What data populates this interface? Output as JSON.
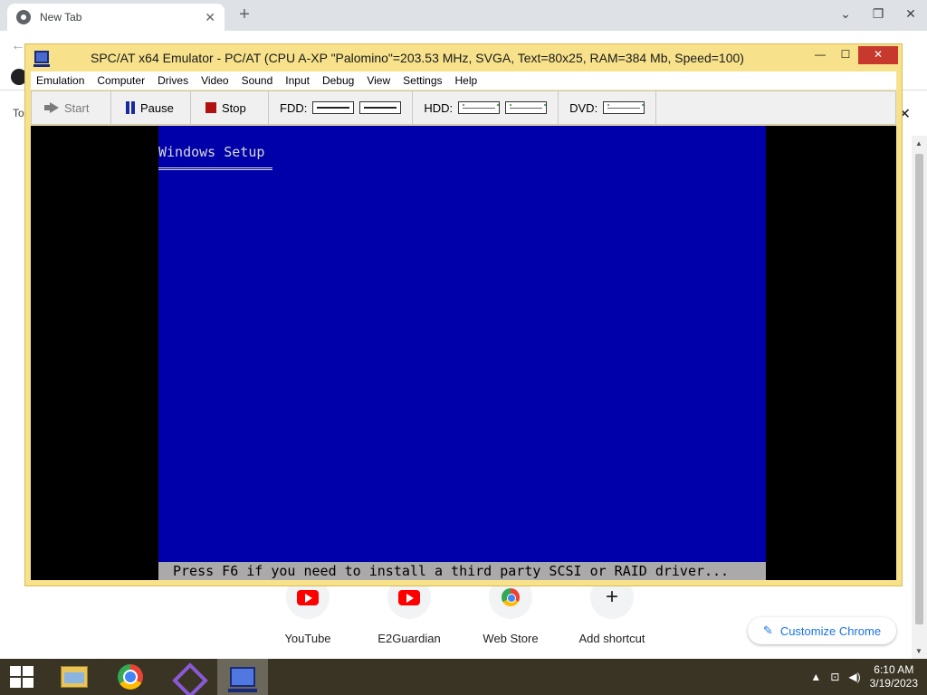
{
  "browser": {
    "tab_title": "New Tab",
    "tab_close": "✕",
    "new_tab": "+",
    "side_label": "To",
    "side_close": "✕",
    "window_controls": [
      "⌄",
      "❐",
      "✕"
    ]
  },
  "shortcuts": [
    {
      "label": "YouTube",
      "icon": "youtube-icon"
    },
    {
      "label": "E2Guardian",
      "icon": "youtube-icon"
    },
    {
      "label": "Web Store",
      "icon": "webstore-icon"
    },
    {
      "label": "Add shortcut",
      "icon": "plus-icon"
    }
  ],
  "customize": {
    "label": "Customize Chrome",
    "icon": "✎"
  },
  "emulator": {
    "title": "SPC/AT x64 Emulator - PC/AT (CPU A-XP \"Palomino\"=203.53 MHz, SVGA, Text=80x25, RAM=384 Mb, Speed=100)",
    "controls": {
      "minimize": "—",
      "maximize": "☐",
      "close": "✕"
    },
    "menu": [
      "Emulation",
      "Computer",
      "Drives",
      "Video",
      "Sound",
      "Input",
      "Debug",
      "View",
      "Settings",
      "Help"
    ],
    "toolbar": {
      "start": "Start",
      "pause": "Pause",
      "stop": "Stop",
      "fdd": "FDD:",
      "hdd": "HDD:",
      "dvd": "DVD:"
    },
    "screen": {
      "title": "Windows Setup",
      "status": "Press F6 if you need to install a third party SCSI or RAID driver...",
      "bg_color": "#0000aa",
      "status_color": "#aaaaaa"
    }
  },
  "taskbar": {
    "apps": [
      "file-explorer-icon",
      "chrome-icon",
      "visual-studio-icon",
      "emulator-icon"
    ],
    "time": "6:10 AM",
    "date": "3/19/2023"
  }
}
